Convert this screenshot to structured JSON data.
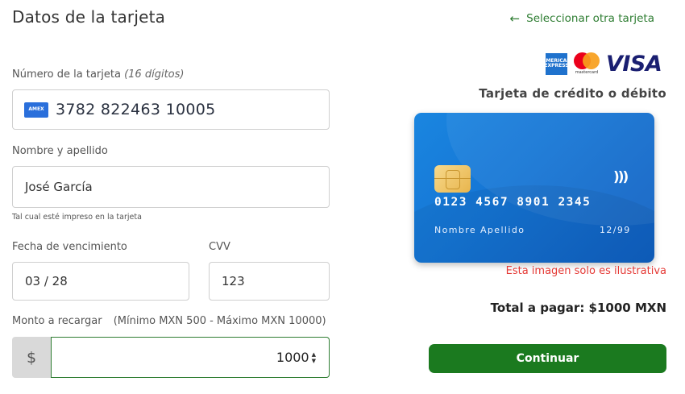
{
  "header": {
    "title": "Datos de la tarjeta",
    "back_link": "Seleccionar otra tarjeta"
  },
  "form": {
    "card_number": {
      "label": "Número de la tarjeta",
      "label_hint": "(16 dígitos)",
      "value": "3782 822463 10005",
      "brand_icon": "AMEX"
    },
    "name": {
      "label": "Nombre y apellido",
      "value": "José García",
      "hint": "Tal cual esté impreso en la tarjeta"
    },
    "expiry": {
      "label": "Fecha de vencimiento",
      "value": "03 / 28"
    },
    "cvv": {
      "label": "CVV",
      "value": "123"
    },
    "amount": {
      "label": "Monto a recargar",
      "range": "(Mínimo MXN 500 - Máximo MXN 10000)",
      "currency_symbol": "$",
      "value": "1000"
    }
  },
  "brands": {
    "amex": "AMERICAN EXPRESS",
    "mastercard": "mastercard",
    "visa": "VISA"
  },
  "card_preview": {
    "type_label": "Tarjeta de crédito o débito",
    "number": "0123 4567 8901 2345",
    "holder": "Nombre Apellido",
    "expiry": "12/99",
    "disclaimer": "Esta imagen solo es ilustrativa"
  },
  "summary": {
    "total": "Total a pagar: $1000 MXN"
  },
  "actions": {
    "continue": "Continuar"
  },
  "colors": {
    "accent_green": "#1b7a1f",
    "link_green": "#2e7d32",
    "card_blue": "#1574d4",
    "warning_red": "#e53935"
  }
}
